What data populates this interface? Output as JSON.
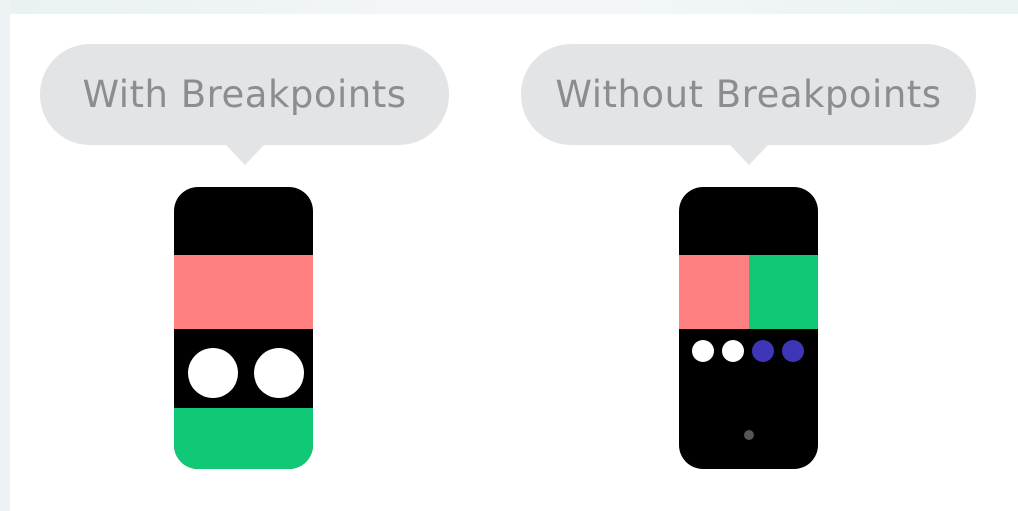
{
  "diagram": {
    "left_panel": {
      "label": "With Breakpoints"
    },
    "right_panel": {
      "label": "Without Breakpoints"
    },
    "colors": {
      "bubble": "#e3e4e6",
      "bubble_text": "#8c8d90",
      "phone_body": "#000000",
      "pink_block": "#ff8080",
      "green_block": "#10c875",
      "white_dot": "#ffffff",
      "purple_dot": "#3e35b7",
      "home_dot": "#555555"
    }
  }
}
